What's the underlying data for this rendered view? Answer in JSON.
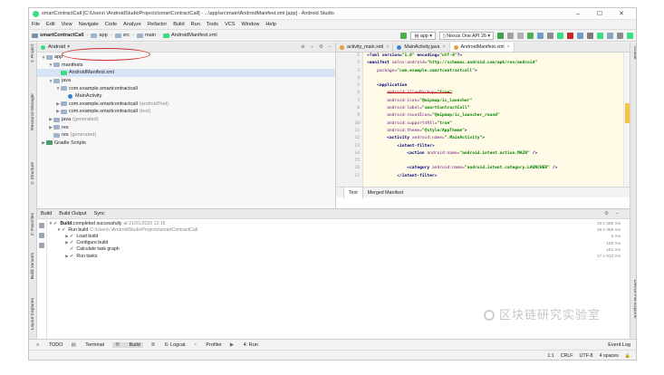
{
  "window": {
    "title": "smartContractCall [C:\\Users\\    \\AndroidStudioProjects\\smartContractCall] - ...\\app\\src\\main\\AndroidManifest.xml [app] - Android Studio",
    "min": "–",
    "max": "☐",
    "close": "✕"
  },
  "menu": [
    "File",
    "Edit",
    "View",
    "Navigate",
    "Code",
    "Analyze",
    "Refactor",
    "Build",
    "Run",
    "Tools",
    "VCS",
    "Window",
    "Help"
  ],
  "nav": {
    "crumbs": [
      "smartContractCall",
      "app",
      "src",
      "main",
      "AndroidManifest.xml"
    ],
    "config": "app",
    "device": "Nexus One API 26"
  },
  "left_tools": [
    "1: Project",
    "Resource Manager",
    "2: Structure",
    "2: Favorites",
    "Build Variants",
    "Layout Captures"
  ],
  "right_tools": [
    "Gradle",
    "Device File Explorer"
  ],
  "project": {
    "view": "Android",
    "tree": [
      {
        "label": "app",
        "note": "",
        "indent": 0,
        "arrow": "▼",
        "icon": "folder"
      },
      {
        "label": "manifests",
        "note": "",
        "indent": 1,
        "arrow": "▼",
        "icon": "folder"
      },
      {
        "label": "AndroidManifest.xml",
        "note": "",
        "indent": 2,
        "arrow": "",
        "icon": "manifest",
        "selected": true
      },
      {
        "label": "java",
        "note": "",
        "indent": 1,
        "arrow": "▼",
        "icon": "folder"
      },
      {
        "label": "com.example.smartcontractcall",
        "note": "",
        "indent": 2,
        "arrow": "▼",
        "icon": "folder"
      },
      {
        "label": "MainActivity",
        "note": "",
        "indent": 3,
        "arrow": "",
        "icon": "class"
      },
      {
        "label": "com.example.smartcontractcall",
        "note": "(androidTest)",
        "indent": 2,
        "arrow": "▶",
        "icon": "folder"
      },
      {
        "label": "com.example.smartcontractcall",
        "note": "(test)",
        "indent": 2,
        "arrow": "▶",
        "icon": "folder"
      },
      {
        "label": "java",
        "note": "(generated)",
        "indent": 1,
        "arrow": "▶",
        "icon": "folder"
      },
      {
        "label": "res",
        "note": "",
        "indent": 1,
        "arrow": "▶",
        "icon": "folder"
      },
      {
        "label": "res",
        "note": "(generated)",
        "indent": 1,
        "arrow": "",
        "icon": "folder"
      },
      {
        "label": "Gradle Scripts",
        "note": "",
        "indent": 0,
        "arrow": "▶",
        "icon": "gradle"
      }
    ]
  },
  "editor": {
    "tabs": [
      {
        "label": "activity_main.xml",
        "active": false
      },
      {
        "label": "MainActivity.java",
        "active": false
      },
      {
        "label": "AndroidManifest.xml",
        "active": true
      }
    ],
    "lines": [
      {
        "n": "1",
        "html": "<span class=\"kw\">&lt;?xml version=</span><span class=\"st\">\"1.0\"</span><span class=\"kw\"> encoding=</span><span class=\"st\">\"utf-8\"</span><span class=\"kw\">?&gt;</span>"
      },
      {
        "n": "2",
        "html": "<span class=\"kw\">&lt;manifest </span><span class=\"at\">xmlns:android=</span><span class=\"st\">\"http://schemas.android.com/apk/res/android\"</span>"
      },
      {
        "n": "3",
        "html": "    <span class=\"at\">package=</span><span class=\"st\">\"com.example.smartcontractcall\"</span><span class=\"kw\">&gt;</span>"
      },
      {
        "n": "4",
        "html": ""
      },
      {
        "n": "5",
        "html": "    <span class=\"kw\">&lt;application</span>"
      },
      {
        "n": "6",
        "html": "        <span class=\"strike\"><span class=\"at\">android:allowBackup=</span><span class=\"st\">\"true\"</span></span>"
      },
      {
        "n": "7",
        "html": "        <span class=\"at\">android:icon=</span><span class=\"st\">\"@mipmap/ic_launcher\"</span>"
      },
      {
        "n": "8",
        "html": "        <span class=\"at\">android:label=</span><span class=\"st\">\"smartContractCall\"</span>"
      },
      {
        "n": "9",
        "html": "        <span class=\"at\">android:roundIcon=</span><span class=\"st\">\"@mipmap/ic_launcher_round\"</span>"
      },
      {
        "n": "10",
        "html": "        <span class=\"at\">android:supportsRtl=</span><span class=\"st\">\"true\"</span>"
      },
      {
        "n": "11",
        "html": "        <span class=\"at\">android:theme=</span><span class=\"st\">\"@style/AppTheme\"</span><span class=\"kw\">&gt;</span>"
      },
      {
        "n": "12",
        "html": "        <span class=\"kw\">&lt;activity </span><span class=\"at\">android:name=</span><span class=\"st\">\".MainActivity\"</span><span class=\"kw\">&gt;</span>"
      },
      {
        "n": "13",
        "html": "            <span class=\"kw\">&lt;intent-filter&gt;</span>"
      },
      {
        "n": "14",
        "html": "                <span class=\"kw\">&lt;action </span><span class=\"at\">android:name=</span><span class=\"st\">\"android.intent.action.MAIN\"</span><span class=\"kw\"> /&gt;</span>"
      },
      {
        "n": "15",
        "html": ""
      },
      {
        "n": "16",
        "html": "                <span class=\"kw\">&lt;category </span><span class=\"at\">android:name=</span><span class=\"st\">\"android.intent.category.LAUNCHER\"</span><span class=\"kw\"> /&gt;</span>"
      },
      {
        "n": "17",
        "html": "            <span class=\"kw\">&lt;/intent-filter&gt;</span>"
      }
    ],
    "bottom_tabs": [
      {
        "label": "Text",
        "active": true
      },
      {
        "label": "Merged Manifest",
        "active": false
      }
    ]
  },
  "build": {
    "tabs": [
      "Build",
      "Build Output",
      "Sync"
    ],
    "rows": [
      {
        "indent": 0,
        "arrow": "▼",
        "check": true,
        "bold": "Build:",
        "text": " completed successfully",
        "muted": "at 21/01/2020 12:15"
      },
      {
        "indent": 1,
        "arrow": "▼",
        "check": true,
        "bold": "",
        "text": "Run build",
        "muted": "C:\\Users\\    \\AndroidStudioProjects\\smartContractCall"
      },
      {
        "indent": 2,
        "arrow": "▶",
        "check": true,
        "bold": "",
        "text": "Load build",
        "muted": ""
      },
      {
        "indent": 2,
        "arrow": "▶",
        "check": true,
        "bold": "",
        "text": "Configure build",
        "muted": ""
      },
      {
        "indent": 2,
        "arrow": "",
        "check": true,
        "bold": "",
        "text": "Calculate task graph",
        "muted": ""
      },
      {
        "indent": 2,
        "arrow": "▶",
        "check": true,
        "bold": "",
        "text": "Run tasks",
        "muted": ""
      }
    ],
    "times": [
      "19 s 385 ms",
      "18 s 368 ms",
      "8 ms",
      "158 ms",
      "151 ms",
      "17 s 912 ms"
    ]
  },
  "watermark": "区块链研究实验室",
  "footer": {
    "tools": [
      "TODO",
      "Terminal",
      "Build",
      "6: Logcat",
      "Profiler",
      "4: Run"
    ],
    "event_log": "Event Log"
  },
  "status": [
    "1:1",
    "CRLF",
    "UTF-8",
    "4 spaces"
  ],
  "colors": {
    "accent": "#3ddc84",
    "selection": "#d6e4f5",
    "annotation": "#d32f2f"
  }
}
